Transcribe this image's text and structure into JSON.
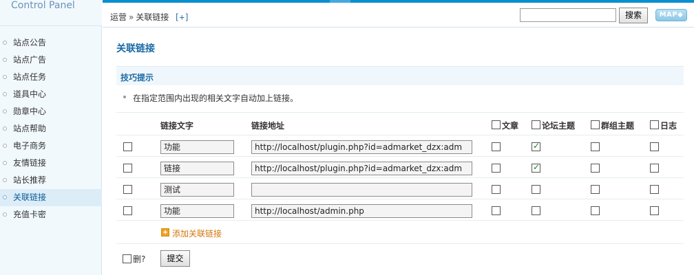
{
  "sidebar": {
    "logo": "Control Panel",
    "items": [
      {
        "label": "站点公告"
      },
      {
        "label": "站点广告"
      },
      {
        "label": "站点任务"
      },
      {
        "label": "道具中心"
      },
      {
        "label": "勋章中心"
      },
      {
        "label": "站点帮助"
      },
      {
        "label": "电子商务"
      },
      {
        "label": "友情链接"
      },
      {
        "label": "站长推荐"
      },
      {
        "label": "关联链接"
      },
      {
        "label": "充值卡密"
      }
    ],
    "active_index": 9
  },
  "header": {
    "breadcrumb": [
      "运营",
      "关联链接"
    ],
    "breadcrumb_sep": "»",
    "add_shortcut": "[+]",
    "search_placeholder": "",
    "search_button": "搜索",
    "map_button": "MAP◆"
  },
  "main": {
    "title": "关联链接",
    "tips_title": "技巧提示",
    "tip": "在指定范围内出现的相关文字自动加上链接。",
    "columns": {
      "text": "链接文字",
      "url": "链接地址",
      "article": "文章",
      "forum": "论坛主题",
      "group": "群组主题",
      "blog": "日志"
    },
    "rows": [
      {
        "text": "功能",
        "url": "http://localhost/plugin.php?id=admarket_dzx:adm",
        "article": false,
        "forum": true,
        "group": false,
        "blog": false
      },
      {
        "text": "链接",
        "url": "http://localhost/plugin.php?id=admarket_dzx:adm",
        "article": false,
        "forum": true,
        "group": false,
        "blog": false
      },
      {
        "text": "测试",
        "url": "",
        "article": false,
        "forum": false,
        "group": false,
        "blog": false
      },
      {
        "text": "功能",
        "url": "http://localhost/admin.php",
        "article": false,
        "forum": false,
        "group": false,
        "blog": false
      }
    ],
    "add_link": "添加关联链接",
    "delete_label": "删?",
    "submit": "提交"
  },
  "colors": {
    "accent": "#0b8fd1",
    "title": "#1b6aa5",
    "sidebar_bg": "#f2f9fd",
    "active_bg": "#dcedf8",
    "add_link": "#d2780a",
    "check": "#1e7a1e"
  }
}
